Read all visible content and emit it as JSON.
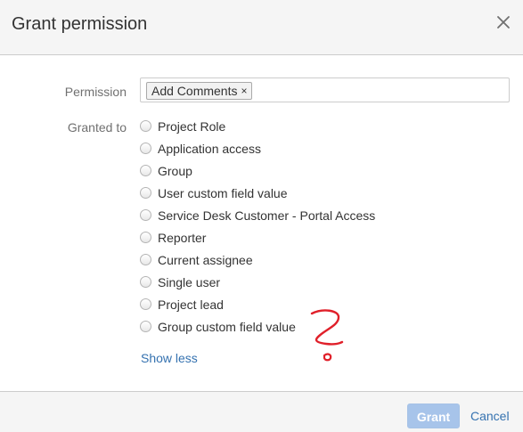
{
  "dialog": {
    "title": "Grant permission",
    "close_icon": "close-icon"
  },
  "permission": {
    "label": "Permission",
    "selected_chip": "Add Comments",
    "chip_remove": "×"
  },
  "granted_to": {
    "label": "Granted to",
    "options": [
      "Project Role",
      "Application access",
      "Group",
      "User custom field value",
      "Service Desk Customer - Portal Access",
      "Reporter",
      "Current assignee",
      "Single user",
      "Project lead",
      "Group custom field value"
    ],
    "toggle_link": "Show less"
  },
  "annotation": {
    "text": "?",
    "color": "#e0202a"
  },
  "footer": {
    "grant_label": "Grant",
    "cancel_label": "Cancel"
  },
  "colors": {
    "link": "#3572b0",
    "disabled_primary": "#a7c4ea",
    "header_bg": "#f5f5f5"
  }
}
